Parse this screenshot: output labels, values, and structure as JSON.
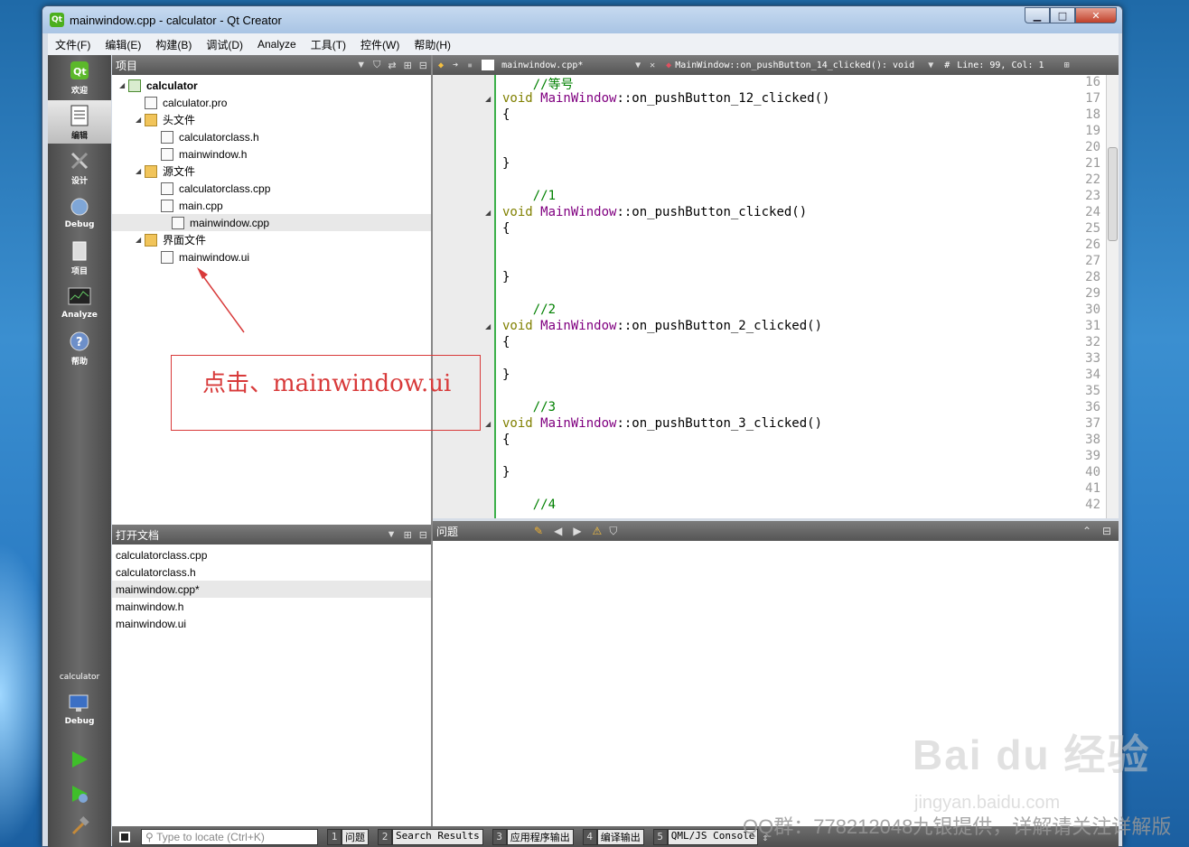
{
  "window": {
    "title": "mainwindow.cpp - calculator - Qt Creator",
    "logo": "Qt",
    "min": "▁",
    "max": "□",
    "close": "✕"
  },
  "menu": [
    "文件(F)",
    "编辑(E)",
    "构建(B)",
    "调试(D)",
    "Analyze",
    "工具(T)",
    "控件(W)",
    "帮助(H)"
  ],
  "modes": [
    {
      "label": "欢迎",
      "icon": "qt-welcome-icon"
    },
    {
      "label": "编辑",
      "icon": "edit-document-icon",
      "active": true
    },
    {
      "label": "设计",
      "icon": "design-tools-icon"
    },
    {
      "label": "Debug",
      "icon": "debug-bug-icon"
    },
    {
      "label": "项目",
      "icon": "project-icon"
    },
    {
      "label": "Analyze",
      "icon": "analyze-monitor-icon"
    },
    {
      "label": "帮助",
      "icon": "help-icon"
    }
  ],
  "kit": {
    "project": "calculator",
    "config": "Debug"
  },
  "project_panel": {
    "title": "项目",
    "tree": [
      {
        "label": "calculator",
        "level": 0,
        "expanded": true,
        "icon": "project",
        "bold": true
      },
      {
        "label": "calculator.pro",
        "level": 1,
        "icon": "pro"
      },
      {
        "label": "头文件",
        "level": 1,
        "expanded": true,
        "icon": "folder"
      },
      {
        "label": "calculatorclass.h",
        "level": 2,
        "icon": "file"
      },
      {
        "label": "mainwindow.h",
        "level": 2,
        "icon": "file"
      },
      {
        "label": "源文件",
        "level": 1,
        "expanded": true,
        "icon": "folder"
      },
      {
        "label": "calculatorclass.cpp",
        "level": 2,
        "icon": "file"
      },
      {
        "label": "main.cpp",
        "level": 2,
        "icon": "file"
      },
      {
        "label": "mainwindow.cpp",
        "level": 2,
        "icon": "file",
        "selected": true
      },
      {
        "label": "界面文件",
        "level": 1,
        "expanded": true,
        "icon": "folder"
      },
      {
        "label": "mainwindow.ui",
        "level": 2,
        "icon": "ui"
      }
    ]
  },
  "open_docs": {
    "title": "打开文档",
    "items": [
      "calculatorclass.cpp",
      "calculatorclass.h",
      "mainwindow.cpp*",
      "mainwindow.h",
      "mainwindow.ui"
    ],
    "selected_index": 2
  },
  "editor": {
    "file": "mainwindow.cpp*",
    "symbol": "MainWindow::on_pushButton_14_clicked(): void",
    "hash": "#",
    "position": "Line: 99, Col: 1",
    "lines": [
      {
        "n": "16",
        "code": "    //等号",
        "kind": "comment"
      },
      {
        "n": "17",
        "code": "void MainWindow::on_pushButton_12_clicked()",
        "kind": "func",
        "fold": true
      },
      {
        "n": "18",
        "code": "{"
      },
      {
        "n": "19",
        "code": ""
      },
      {
        "n": "20",
        "code": ""
      },
      {
        "n": "21",
        "code": "}"
      },
      {
        "n": "22",
        "code": ""
      },
      {
        "n": "23",
        "code": "    //1",
        "kind": "comment"
      },
      {
        "n": "24",
        "code": "void MainWindow::on_pushButton_clicked()",
        "kind": "func",
        "fold": true
      },
      {
        "n": "25",
        "code": "{"
      },
      {
        "n": "26",
        "code": ""
      },
      {
        "n": "27",
        "code": ""
      },
      {
        "n": "28",
        "code": "}"
      },
      {
        "n": "29",
        "code": ""
      },
      {
        "n": "30",
        "code": "    //2",
        "kind": "comment"
      },
      {
        "n": "31",
        "code": "void MainWindow::on_pushButton_2_clicked()",
        "kind": "func",
        "fold": true
      },
      {
        "n": "32",
        "code": "{"
      },
      {
        "n": "33",
        "code": ""
      },
      {
        "n": "34",
        "code": "}"
      },
      {
        "n": "35",
        "code": ""
      },
      {
        "n": "36",
        "code": "    //3",
        "kind": "comment"
      },
      {
        "n": "37",
        "code": "void MainWindow::on_pushButton_3_clicked()",
        "kind": "func",
        "fold": true
      },
      {
        "n": "38",
        "code": "{"
      },
      {
        "n": "39",
        "code": ""
      },
      {
        "n": "40",
        "code": "}"
      },
      {
        "n": "41",
        "code": ""
      },
      {
        "n": "42",
        "code": "    //4",
        "kind": "comment"
      }
    ]
  },
  "issues": {
    "title": "问题"
  },
  "statusbar": {
    "locator_placeholder": "Type to locate (Ctrl+K)",
    "tabs": [
      {
        "num": "1",
        "label": "问题"
      },
      {
        "num": "2",
        "label": "Search Results"
      },
      {
        "num": "3",
        "label": "应用程序输出"
      },
      {
        "num": "4",
        "label": "编译输出"
      },
      {
        "num": "5",
        "label": "QML/JS Console"
      }
    ]
  },
  "annotation": {
    "text": "点击、mainwindow.ui",
    "color": "#d83a3a"
  },
  "watermark": {
    "brand": "Bai du 经验",
    "site": "jingyan.baidu.com",
    "qq": "QQ群：778212048九银提供，详解请关注详解版"
  }
}
